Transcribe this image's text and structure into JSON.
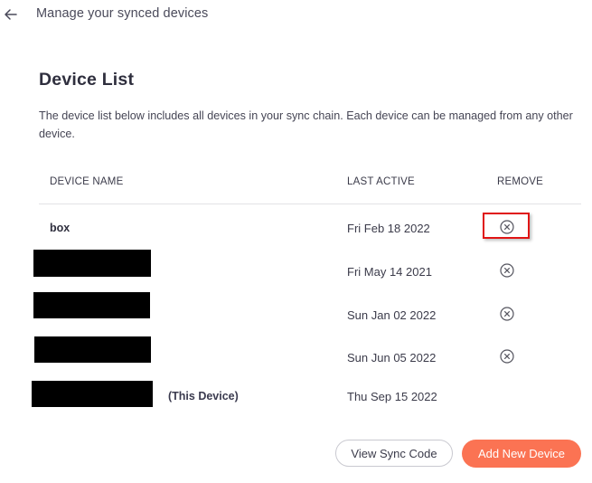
{
  "topbar": {
    "back_icon": "arrow-left-icon",
    "title": "Manage your synced devices"
  },
  "main": {
    "heading": "Device List",
    "description": "The device list below includes all devices in your sync chain. Each device can be managed from any other device."
  },
  "table": {
    "columns": [
      "DEVICE NAME",
      "LAST ACTIVE",
      "REMOVE"
    ],
    "rows": [
      {
        "name": "box",
        "redacted": false,
        "suffix": "",
        "last_active": "Fri Feb 18 2022",
        "removable": true,
        "highlighted": true
      },
      {
        "name": "",
        "redacted": true,
        "suffix": "",
        "last_active": "Fri May 14 2021",
        "removable": true,
        "highlighted": false
      },
      {
        "name": "",
        "redacted": true,
        "suffix": "",
        "last_active": "Sun Jan 02 2022",
        "removable": true,
        "highlighted": false
      },
      {
        "name": "",
        "redacted": true,
        "suffix": "",
        "last_active": "Sun Jun 05 2022",
        "removable": true,
        "highlighted": false
      },
      {
        "name": "",
        "redacted": true,
        "suffix": "(This Device)",
        "last_active": "Thu Sep 15 2022",
        "removable": false,
        "highlighted": false
      }
    ],
    "remove_icon": "close-circle-icon"
  },
  "actions": {
    "view_sync_code_label": "View Sync Code",
    "add_new_device_label": "Add New Device"
  },
  "colors": {
    "accent": "#fb7353",
    "highlight": "#e01515",
    "text": "#3b3b4f"
  }
}
